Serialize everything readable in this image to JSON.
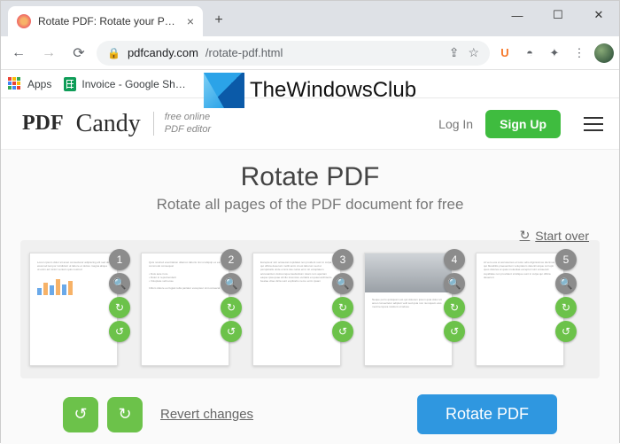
{
  "browser": {
    "tab_title": "Rotate PDF: Rotate your PDF doc…",
    "url_host": "pdfcandy.com",
    "url_path": "/rotate-pdf.html",
    "bookmarks": {
      "apps": "Apps",
      "invoice": "Invoice - Google Sh…"
    },
    "ext_u": "U"
  },
  "watermark": "TheWindowsClub",
  "header": {
    "logo_pdf": "PDF",
    "logo_candy": "Candy",
    "tagline1": "free online",
    "tagline2": "PDF editor",
    "login": "Log In",
    "signup": "Sign Up"
  },
  "page": {
    "title": "Rotate PDF",
    "subtitle": "Rotate all pages of the PDF document for free",
    "start_over": "Start over"
  },
  "thumbs": [
    {
      "num": "1"
    },
    {
      "num": "2"
    },
    {
      "num": "3"
    },
    {
      "num": "4"
    },
    {
      "num": "5"
    }
  ],
  "actions": {
    "revert": "Revert changes",
    "rotate": "Rotate PDF"
  }
}
